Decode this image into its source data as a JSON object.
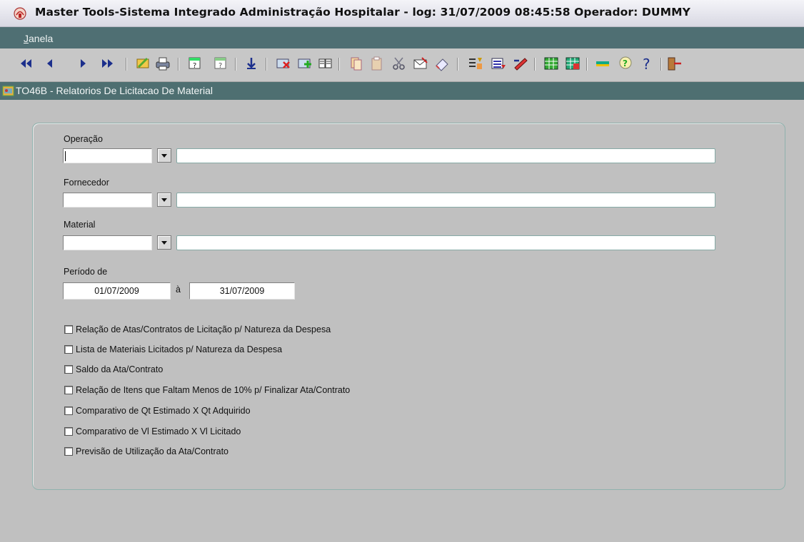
{
  "window": {
    "title": "Master Tools-Sistema Integrado Administração Hospitalar -  log: 31/07/2009 08:45:58 Operador: DUMMY"
  },
  "menu": {
    "items": [
      {
        "first": "J",
        "rest": "anela"
      }
    ]
  },
  "toolbar": {
    "buttons": [
      "first-record-icon",
      "previous-record-icon",
      "next-record-icon",
      "last-record-icon",
      "edit-icon",
      "print-icon",
      "query-icon",
      "execute-query-icon",
      "save-icon",
      "clear-record-icon",
      "insert-record-icon",
      "duplicate-record-icon",
      "copy-icon",
      "paste-icon",
      "cut-icon",
      "mail-icon",
      "eraser-icon",
      "list-icon",
      "list-values-icon",
      "edit-field-icon",
      "grid-icon",
      "grid-alt-icon",
      "color-icon",
      "help-hint-icon",
      "help-icon",
      "exit-icon"
    ]
  },
  "form": {
    "title": "TO46B - Relatorios De Licitacao De Material"
  },
  "fields": {
    "operacao": {
      "label": "Operação",
      "code": "",
      "description": ""
    },
    "fornecedor": {
      "label": "Fornecedor",
      "code": "",
      "description": ""
    },
    "material": {
      "label": "Material",
      "code": "",
      "description": ""
    },
    "periodo": {
      "label": "Período de",
      "from": "01/07/2009",
      "separator": "à",
      "to": "31/07/2009"
    }
  },
  "reports": [
    {
      "label": "Relação de Atas/Contratos de Licitação p/ Natureza da Despesa",
      "checked": false
    },
    {
      "label": "Lista de Materiais Licitados p/ Natureza da Despesa",
      "checked": false
    },
    {
      "label": "Saldo da Ata/Contrato",
      "checked": false
    },
    {
      "label": "Relação de Itens que Faltam Menos de 10% p/ Finalizar Ata/Contrato",
      "checked": false
    },
    {
      "label": "Comparativo de Qt Estimado X Qt Adquirido",
      "checked": false
    },
    {
      "label": "Comparativo de Vl Estimado X Vl Licitado",
      "checked": false
    },
    {
      "label": "Previsão de Utilização da Ata/Contrato",
      "checked": false
    }
  ],
  "colors": {
    "titlebar": "#e6e6ee",
    "menubar": "#4f6f73",
    "form_title": "#4e6f71",
    "background": "#c0c0c0",
    "panel_border": "#8fb2ad"
  }
}
